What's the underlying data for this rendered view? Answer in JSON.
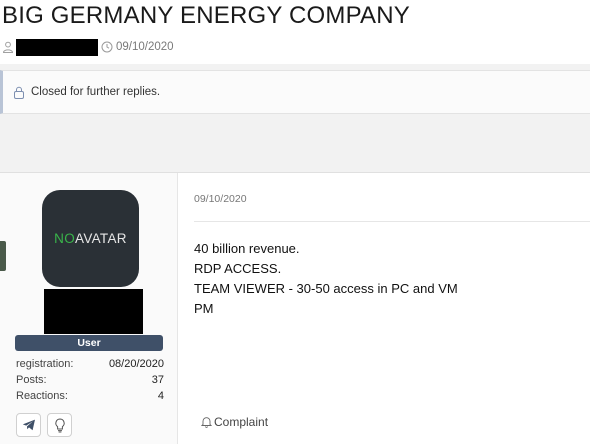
{
  "thread": {
    "title": "BIG GERMANY ENERGY COMPANY",
    "date": "09/10/2020"
  },
  "notice": {
    "text": "Closed for further replies."
  },
  "post": {
    "author": {
      "avatar_text_1": "NO",
      "avatar_text_2": "AVATAR",
      "role": "User",
      "stats": [
        {
          "label": "registration:",
          "value": "08/20/2020"
        },
        {
          "label": "Posts:",
          "value": "37"
        },
        {
          "label": "Reactions:",
          "value": "4"
        }
      ],
      "buttons": [
        "telegram-icon",
        "lightbulb-icon"
      ]
    },
    "date": "09/10/2020",
    "body": [
      "40 billion revenue.",
      "RDP ACCESS.",
      "TEAM VIEWER - 30-50 access in PC and VM",
      "PM"
    ],
    "complaint_label": "Complaint"
  },
  "colors": {
    "role_badge": "#3f5068",
    "avatar_bg": "#2a3036",
    "avatar_no": "#39b54a"
  }
}
